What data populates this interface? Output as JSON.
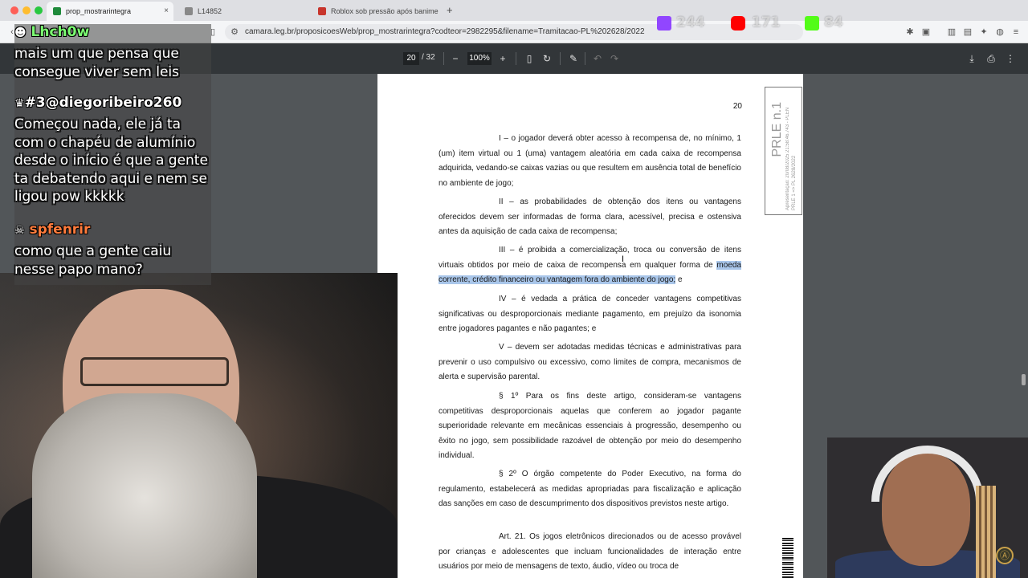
{
  "browser": {
    "tabs": [
      {
        "title": "prop_mostrarintegra",
        "icon_color": "#1f8a3b",
        "active": true
      },
      {
        "title": "L14852",
        "icon_color": "#888888",
        "active": false
      },
      {
        "title": "Roblox sob pressão após banime",
        "icon_color": "#c8352c",
        "active": false
      }
    ],
    "new_tab": "+",
    "close": "×",
    "url": "camara.leg.br/proposicoesWeb/prop_mostrarintegra?codteor=2982295&filename=Tramitacao-PL%202628/2022"
  },
  "pdf_toolbar": {
    "current_page": "20",
    "total_pages": "/ 32",
    "zoom": "100%",
    "zoom_out": "−",
    "zoom_in": "+"
  },
  "document": {
    "page_number": "20",
    "paragraphs": [
      {
        "text": "I – o jogador deverá obter acesso à recompensa de, no mínimo, 1 (um) item virtual ou 1 (uma) vantagem aleatória em cada caixa de recompensa adquirida, vedando-se caixas vazias ou que resultem em ausência total de benefício no ambiente de jogo;"
      },
      {
        "text": "II – as probabilidades de obtenção dos itens ou vantagens oferecidos devem ser informadas de forma clara, acessível, precisa e ostensiva antes da aquisição de cada caixa de recompensa;"
      },
      {
        "text_before": "III – é proibida a comercialização, troca ou conversão de itens virtuais obtidos por meio de caixa de recompensa  em qualquer forma de ",
        "highlighted": "moeda corrente, crédito financeiro ou vantagem fora do ambiente do jogo;",
        "text_after": " e"
      },
      {
        "text": "IV – é vedada a prática de conceder vantagens competitivas significativas ou desproporcionais mediante pagamento, em prejuízo da isonomia entre jogadores pagantes e não pagantes; e"
      },
      {
        "text": "V – devem ser adotadas medidas técnicas e administrativas para prevenir o uso compulsivo ou excessivo, como limites de compra, mecanismos de alerta e supervisão parental."
      },
      {
        "text": "§ 1º Para os fins deste artigo, consideram-se vantagens competitivas desproporcionais aquelas que conferem ao jogador pagante superioridade relevante em mecânicas essenciais à progressão, desempenho ou êxito no jogo, sem possibilidade razoável de obtenção por meio do desempenho individual."
      },
      {
        "text": "§ 2º O órgão competente do Poder Executivo, na forma do regulamento, estabelecerá as medidas apropriadas para fiscalização e aplicação das sanções em caso de descumprimento dos dispositivos previstos neste artigo."
      },
      {
        "text": "Art. 21. Os jogos eletrônicos direcionados ou de acesso provável por crianças e adolescentes que incluam funcionalidades de interação entre usuários por meio de mensagens de texto, áudio, vídeo ou troca de"
      }
    ],
    "stamp_main": "PRLE n.1",
    "stamp_small": "Apresentação: 20/08/2025 21:58:46.743 - PLEN PRLE 1 => PL 2628/2022"
  },
  "chat": [
    {
      "user": "Lhch0w",
      "message": "mais um que pensa que consegue viver sem leis"
    },
    {
      "user": "#3@diegoribeiro260",
      "message": "Começou nada, ele já ta com o chapéu de alumínio desde o início é que a gente ta debatendo aqui e nem se ligou pow kkkkk"
    },
    {
      "user": "spfenrir",
      "message": "como que a gente caiu nesse papo mano?"
    }
  ],
  "socials": {
    "twitch": "244",
    "youtube": "171",
    "kick": "84",
    "colors": {
      "twitch": "#9146ff",
      "youtube": "#ff0000",
      "kick": "#53fc18"
    }
  }
}
